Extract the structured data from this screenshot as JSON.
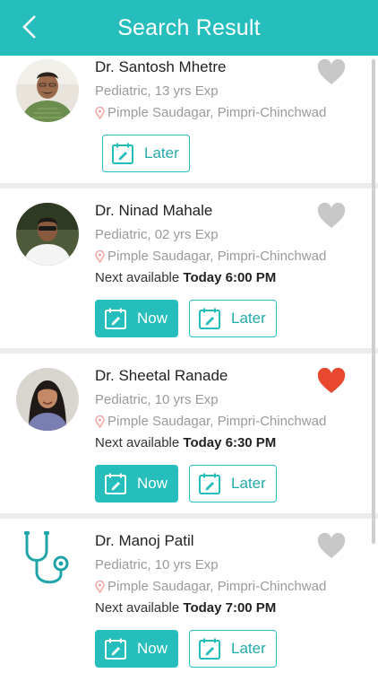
{
  "header": {
    "title": "Search Result"
  },
  "doctors": [
    {
      "name": "Dr. Santosh Mhetre",
      "spec": "Pediatric, 13 yrs Exp",
      "location": "Pimple Saudagar, Pimpri-Chinchwad",
      "availability_prefix": "",
      "availability_time": "",
      "favorite": false
    },
    {
      "name": "Dr. Ninad Mahale",
      "spec": "Pediatric, 02 yrs Exp",
      "location": "Pimple Saudagar, Pimpri-Chinchwad",
      "availability_prefix": "Next available",
      "availability_time": "Today 6:00 PM",
      "favorite": false
    },
    {
      "name": "Dr. Sheetal Ranade",
      "spec": "Pediatric, 10 yrs Exp",
      "location": "Pimple Saudagar, Pimpri-Chinchwad",
      "availability_prefix": "Next available",
      "availability_time": "Today 6:30 PM",
      "favorite": true
    },
    {
      "name": "Dr. Manoj Patil",
      "spec": "Pediatric, 10 yrs Exp",
      "location": "Pimple Saudagar, Pimpri-Chinchwad",
      "availability_prefix": "Next available",
      "availability_time": "Today 7:00 PM",
      "favorite": false
    }
  ],
  "buttons": {
    "now": "Now",
    "later": "Later"
  },
  "colors": {
    "accent": "#26bdbd",
    "favorite": "#e8482e",
    "heart_inactive": "#c7c7c7"
  }
}
